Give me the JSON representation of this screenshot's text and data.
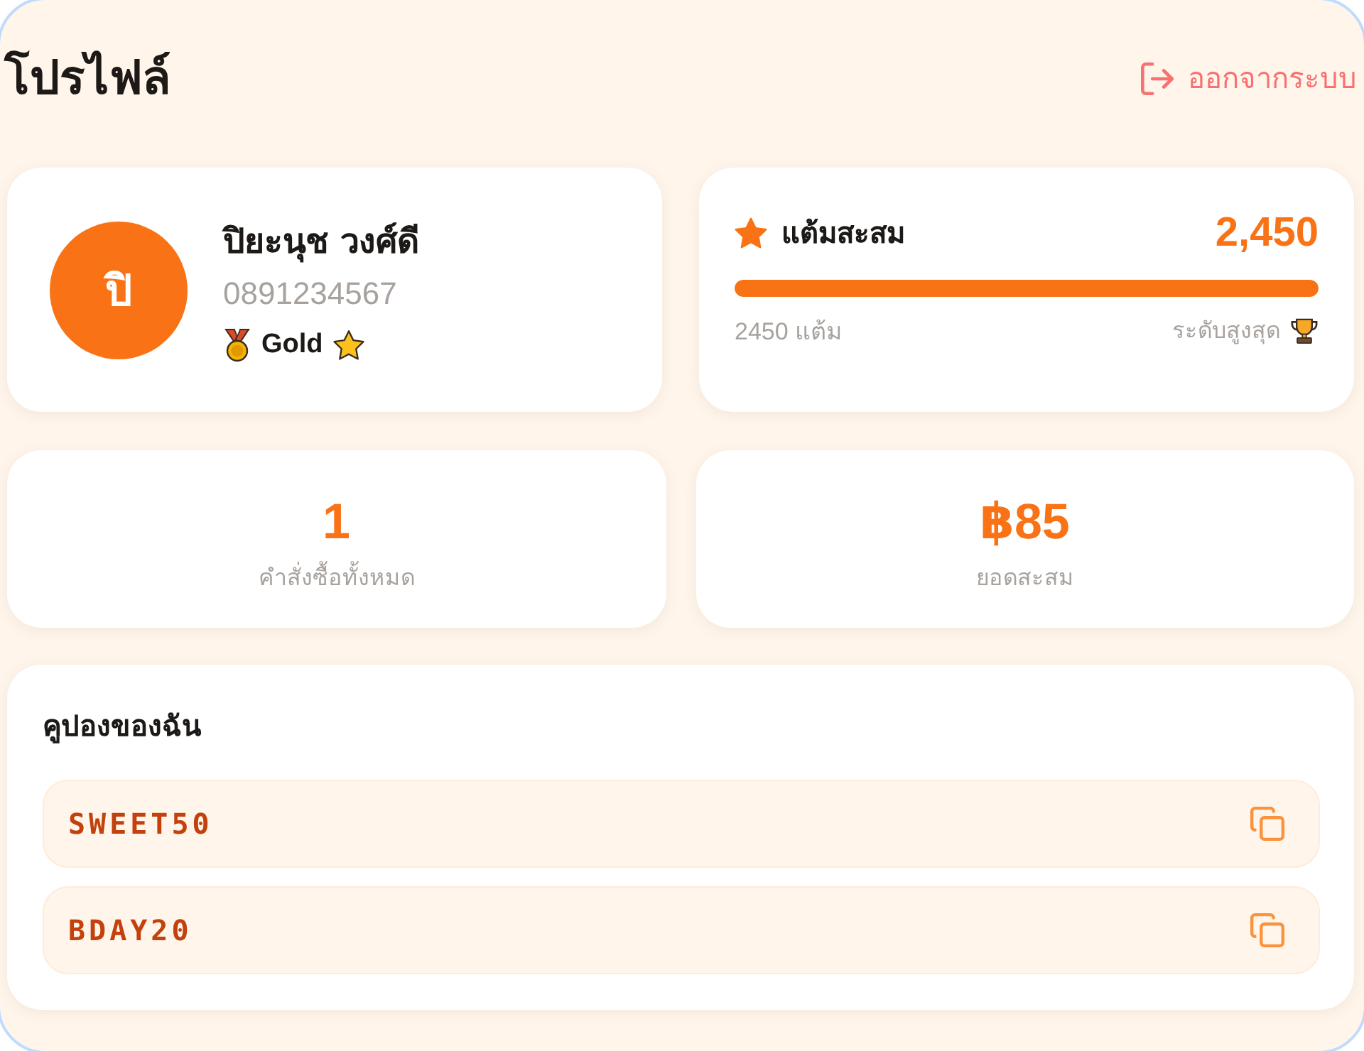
{
  "header": {
    "title": "โปรไฟล์",
    "logout": {
      "label": "ออกจากระบบ"
    }
  },
  "profile": {
    "avatar_initial": "ปิ",
    "name": "ปิยะนุช วงศ์ดี",
    "phone": "0891234567",
    "tier": "Gold"
  },
  "points": {
    "label": "แต้มสะสม",
    "value": "2,450",
    "level": 1,
    "points_text": "2450 แต้ม",
    "tier_status": "ระดับสูงสุด"
  },
  "stats": [
    {
      "value": "1",
      "label": "คำสั่งซื้อทั้งหมด"
    },
    {
      "value": "฿85",
      "label": "ยอดสะสม"
    }
  ],
  "coupons": {
    "title": "คูปองของฉัน",
    "items": [
      {
        "code": "SWEET50"
      },
      {
        "code": "BDAY20"
      }
    ]
  }
}
